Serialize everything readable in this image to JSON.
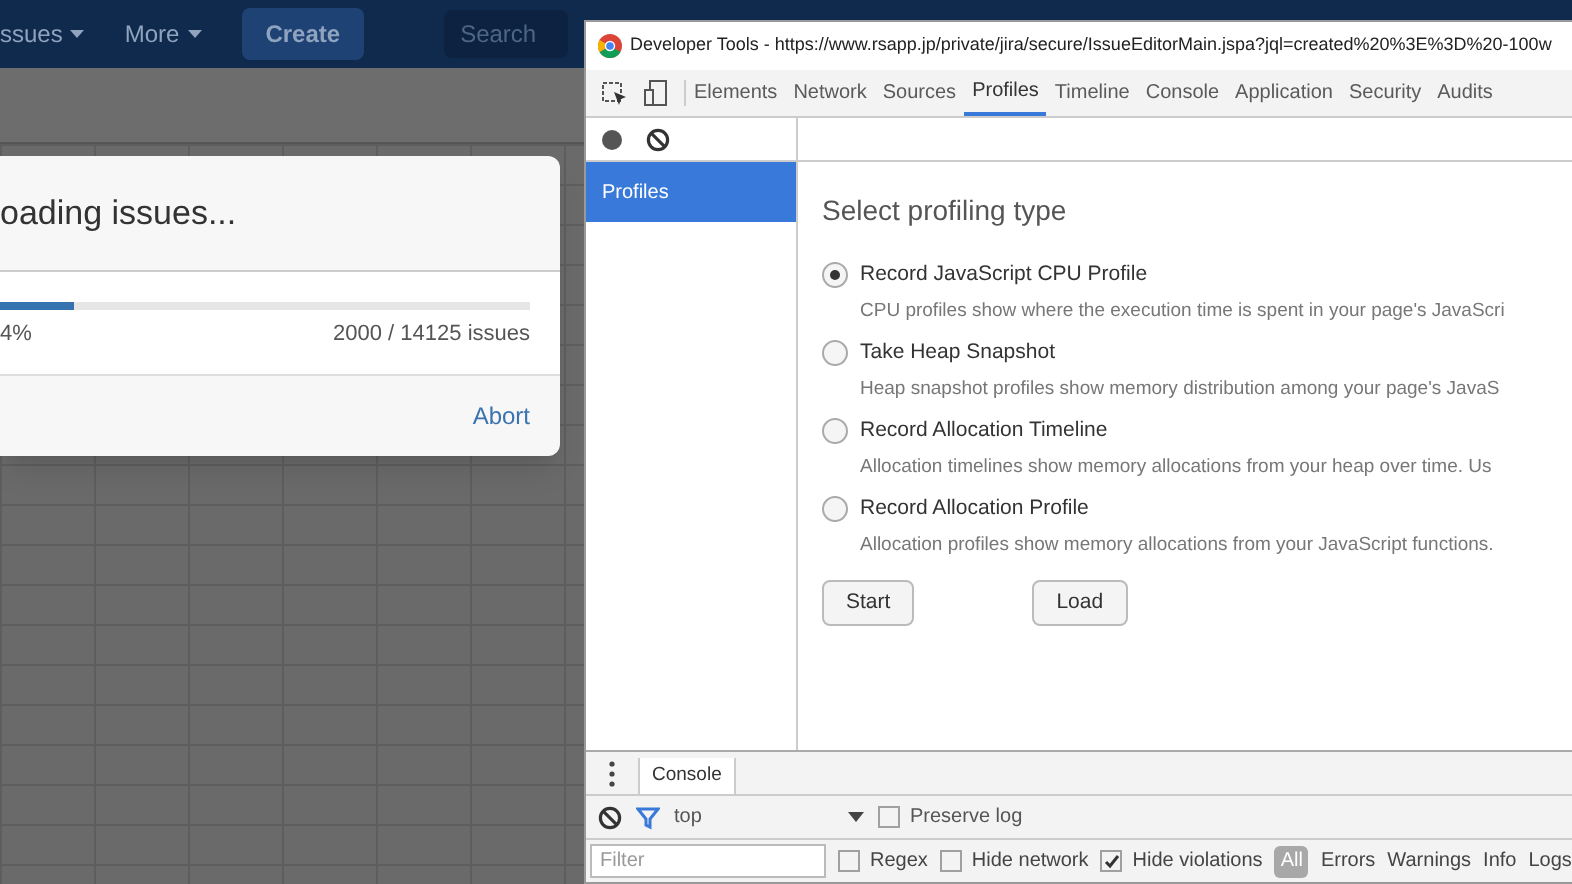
{
  "jira": {
    "nav_items": [
      {
        "label": "ssues"
      },
      {
        "label": "More"
      }
    ],
    "create_button": "Create",
    "search": {
      "placeholder": "Search"
    },
    "dialog": {
      "title": "oading issues...",
      "level": 0.14,
      "percent": "4%",
      "count": "2000 / 14125 issues",
      "abort": "Abort"
    }
  },
  "devtools": {
    "title": "Developer Tools - https://www.rsapp.jp/private/jira/secure/IssueEditorMain.jspa?jql=created%20%3E%3D%20-100w",
    "tabs": [
      {
        "label": "Elements",
        "selected": false
      },
      {
        "label": "Network",
        "selected": false
      },
      {
        "label": "Sources",
        "selected": false
      },
      {
        "label": "Profiles",
        "selected": true
      },
      {
        "label": "Timeline",
        "selected": false
      },
      {
        "label": "Console",
        "selected": false
      },
      {
        "label": "Application",
        "selected": false
      },
      {
        "label": "Security",
        "selected": false
      },
      {
        "label": "Audits",
        "selected": false
      }
    ],
    "sidebar": {
      "items": [
        {
          "label": "Profiles",
          "selected": true
        }
      ]
    },
    "heading": "Select profiling type",
    "options": [
      {
        "label": "Record JavaScript CPU Profile",
        "description": "CPU profiles show where the execution time is spent in your page's JavaScri",
        "selected": true
      },
      {
        "label": "Take Heap Snapshot",
        "description": "Heap snapshot profiles show memory distribution among your page's JavaS",
        "selected": false
      },
      {
        "label": "Record Allocation Timeline",
        "description": "Allocation timelines show memory allocations from your heap over time. Us",
        "selected": false
      },
      {
        "label": "Record Allocation Profile",
        "description": "Allocation profiles show memory allocations from your JavaScript functions.",
        "selected": false
      }
    ],
    "buttons": [
      "Start",
      "Load"
    ],
    "drawer": {
      "tab": "Console",
      "context": "top",
      "preserve_log": {
        "label": "Preserve log",
        "checked": false
      },
      "filter": {
        "placeholder": "Filter"
      },
      "checkboxes": [
        {
          "label": "Regex",
          "checked": false
        },
        {
          "label": "Hide network",
          "checked": false
        },
        {
          "label": "Hide violations",
          "checked": true
        }
      ],
      "levels_badge": "All",
      "levels": [
        "Errors",
        "Warnings",
        "Info",
        "Logs"
      ]
    }
  }
}
